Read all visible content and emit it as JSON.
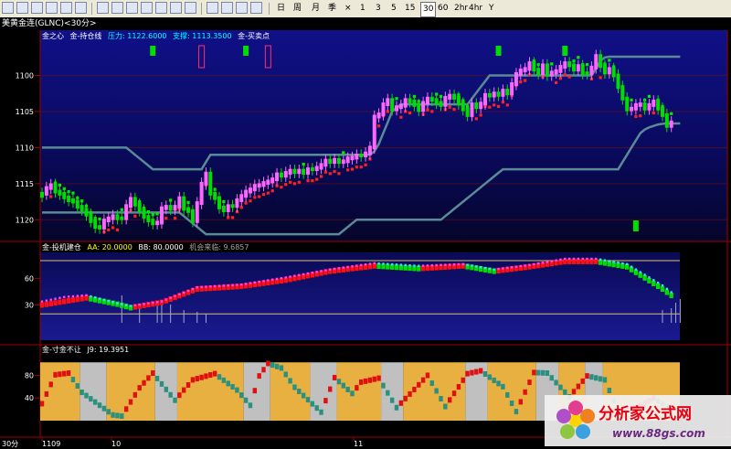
{
  "toolbar": {
    "period_buttons": [
      "日",
      "周",
      "月",
      "季",
      "×",
      "1",
      "3",
      "5",
      "15",
      "30",
      "60",
      "2hr",
      "4hr",
      "Y"
    ],
    "active_period": "30"
  },
  "window_title": "美黄金连(GLNC)<30分>",
  "colors": {
    "up": "#ff66ff",
    "down": "#00dd00",
    "band": "#5a8a95",
    "dots_red": "#ff2020",
    "dots_green": "#00ee00",
    "cyan": "#40d8ff",
    "gold": "#e8b040",
    "gray": "#c0c0c0",
    "axis_red": "#a00000",
    "teal": "#2a9080"
  },
  "panel1": {
    "title": "金之心",
    "indicator": "金-持仓线",
    "pressure_label": "压力:",
    "pressure_value": "1122.6000",
    "support_label": "支撑:",
    "support_value": "1113.3500",
    "signal_label": "金-买卖点",
    "y_ticks": [
      "1120",
      "1115",
      "1110",
      "1105",
      "1100"
    ]
  },
  "panel2": {
    "title": "金-投机建仓",
    "aa_label": "AA:",
    "aa_value": "20.0000",
    "bb_label": "BB:",
    "bb_value": "80.0000",
    "chance_label": "机会来临:",
    "chance_value": "9.6857",
    "y_ticks": [
      "60",
      "30"
    ]
  },
  "panel3": {
    "title": "金-寸金不让",
    "j_label": "J9:",
    "j_value": "19.3951",
    "y_ticks": [
      "80",
      "40"
    ]
  },
  "x_axis": {
    "unit": "30分",
    "labels": [
      "1109",
      "10",
      "11"
    ]
  },
  "watermark": {
    "brand": "分析家公式网",
    "url": "www.88gs.com"
  },
  "chart_data": [
    {
      "type": "candlestick",
      "title": "金之心",
      "ylim": [
        1097.5,
        1124.5
      ],
      "y_ticks": [
        1100,
        1105,
        1110,
        1115,
        1120
      ],
      "close": [
        1103.6,
        1104.4,
        1104.8,
        1103.9,
        1103.6,
        1103.1,
        1102.7,
        1102.5,
        1101.8,
        1101.4,
        1100.7,
        1099.8,
        1099.0,
        1098.9,
        1099.9,
        1100.2,
        1100.5,
        1100.2,
        1100.2,
        1101.9,
        1102.9,
        1102.1,
        1101.3,
        1100.4,
        1099.9,
        1099.5,
        1099.6,
        1101.6,
        1101.8,
        1101.5,
        1101.8,
        1103.0,
        1101.5,
        1101.2,
        1099.8,
        1102.3,
        1105.0,
        1106.4,
        1103.6,
        1103.0,
        1101.7,
        1101.3,
        1101.9,
        1101.9,
        1102.7,
        1103.3,
        1103.9,
        1104.2,
        1104.7,
        1104.8,
        1105.1,
        1105.3,
        1105.6,
        1106.3,
        1106.1,
        1106.5,
        1106.8,
        1106.6,
        1106.8,
        1106.5,
        1107.0,
        1107.0,
        1107.2,
        1107.6,
        1108.2,
        1108.0,
        1108.3,
        1108.0,
        1108.1,
        1108.5,
        1108.6,
        1108.9,
        1108.9,
        1109.2,
        1110.0,
        1114.3,
        1114.6,
        1116.0,
        1116.6,
        1115.3,
        1115.6,
        1115.8,
        1116.6,
        1116.4,
        1115.9,
        1115.2,
        1116.2,
        1116.8,
        1116.6,
        1116.2,
        1115.9,
        1116.9,
        1117.2,
        1116.9,
        1116.1,
        1115.3,
        1114.5,
        1116.0,
        1115.6,
        1116.1,
        1117.3,
        1117.2,
        1117.5,
        1117.3,
        1117.9,
        1117.5,
        1118.8,
        1120.2,
        1120.7,
        1120.9,
        1121.7,
        1120.8,
        1120.3,
        1121.4,
        1120.1,
        1120.4,
        1120.6,
        1121.2,
        1121.7,
        1121.4,
        1120.8,
        1121.3,
        1120.3,
        1120.3,
        1121.1,
        1122.7,
        1121.3,
        1120.4,
        1120.9,
        1120.0,
        1118.4,
        1116.8,
        1115.3,
        1115.4,
        1115.9,
        1116.0,
        1115.4,
        1115.9,
        1116.4,
        1115.4,
        1114.5,
        1113.0,
        1113.5
      ],
      "up_bar": [
        0,
        1,
        1,
        0,
        0,
        0,
        0,
        0,
        0,
        0,
        0,
        0,
        0,
        0,
        1,
        1,
        1,
        0,
        0,
        1,
        1,
        0,
        0,
        0,
        0,
        0,
        1,
        1,
        1,
        0,
        1,
        1,
        0,
        0,
        0,
        1,
        1,
        1,
        0,
        0,
        0,
        0,
        1,
        0,
        1,
        1,
        1,
        1,
        1,
        1,
        1,
        1,
        1,
        1,
        0,
        1,
        1,
        0,
        1,
        0,
        1,
        0,
        1,
        1,
        1,
        0,
        1,
        0,
        1,
        1,
        1,
        1,
        0,
        1,
        1,
        1,
        1,
        1,
        1,
        0,
        1,
        1,
        1,
        0,
        0,
        0,
        1,
        1,
        0,
        0,
        0,
        1,
        1,
        0,
        0,
        0,
        0,
        1,
        0,
        1,
        1,
        0,
        1,
        0,
        1,
        0,
        1,
        1,
        1,
        1,
        1,
        0,
        0,
        1,
        0,
        1,
        1,
        1,
        1,
        0,
        0,
        1,
        0,
        0,
        1,
        1,
        0,
        0,
        1,
        0,
        0,
        0,
        0,
        1,
        1,
        1,
        0,
        1,
        1,
        0,
        0,
        0,
        1
      ],
      "resistance": [
        1110.0,
        1110.0,
        1110.0,
        1110.0,
        1110.0,
        1110.0,
        1110.0,
        1110.0,
        1110.0,
        1110.0,
        1110.0,
        1110.0,
        1110.0,
        1110.0,
        1110.0,
        1110.0,
        1110.0,
        1110.0,
        1110.0,
        1110.0,
        1109.5,
        1109.0,
        1108.5,
        1108.0,
        1107.5,
        1107.0,
        1107.0,
        1107.0,
        1107.0,
        1107.0,
        1107.0,
        1107.0,
        1107.0,
        1107.0,
        1107.0,
        1107.0,
        1107.0,
        1108.0,
        1109.0,
        1109.0,
        1109.0,
        1109.0,
        1109.0,
        1109.0,
        1109.0,
        1109.0,
        1109.0,
        1109.0,
        1109.0,
        1109.0,
        1109.0,
        1109.0,
        1109.0,
        1109.0,
        1109.0,
        1109.0,
        1109.0,
        1109.0,
        1109.0,
        1109.0,
        1109.0,
        1109.0,
        1109.0,
        1109.0,
        1109.0,
        1109.0,
        1109.0,
        1109.0,
        1109.0,
        1109.0,
        1109.0,
        1109.0,
        1109.0,
        1109.0,
        1109.0,
        1109.5,
        1110.5,
        1112.0,
        1113.5,
        1115.0,
        1115.5,
        1116.0,
        1116.0,
        1116.0,
        1116.0,
        1116.0,
        1116.0,
        1116.0,
        1116.0,
        1116.0,
        1116.0,
        1116.0,
        1116.0,
        1116.0,
        1116.0,
        1116.0,
        1116.0,
        1116.8,
        1117.6,
        1118.4,
        1119.2,
        1120.0,
        1120.0,
        1120.0,
        1120.0,
        1120.0,
        1120.0,
        1120.0,
        1120.0,
        1120.0,
        1120.0,
        1120.0,
        1120.0,
        1120.0,
        1120.0,
        1120.0,
        1120.0,
        1120.0,
        1120.0,
        1120.0,
        1120.0,
        1120.0,
        1120.0,
        1120.0,
        1120.0,
        1121.0,
        1122.0,
        1122.5,
        1122.6,
        1122.6,
        1122.6,
        1122.6,
        1122.6,
        1122.6,
        1122.6,
        1122.6,
        1122.6,
        1122.6,
        1122.6,
        1122.6,
        1122.6,
        1122.6,
        1122.6,
        1122.6,
        1122.6
      ],
      "support": [
        1101.0,
        1101.0,
        1101.0,
        1101.0,
        1101.0,
        1101.0,
        1101.0,
        1101.0,
        1101.0,
        1101.0,
        1101.0,
        1101.0,
        1101.0,
        1101.0,
        1101.0,
        1101.0,
        1101.0,
        1101.0,
        1101.0,
        1101.0,
        1101.0,
        1101.0,
        1101.0,
        1101.0,
        1101.0,
        1101.0,
        1101.0,
        1101.0,
        1101.0,
        1101.0,
        1101.0,
        1101.0,
        1100.5,
        1100.0,
        1099.5,
        1099.0,
        1098.5,
        1098.0,
        1098.0,
        1098.0,
        1098.0,
        1098.0,
        1098.0,
        1098.0,
        1098.0,
        1098.0,
        1098.0,
        1098.0,
        1098.0,
        1098.0,
        1098.0,
        1098.0,
        1098.0,
        1098.0,
        1098.0,
        1098.0,
        1098.0,
        1098.0,
        1098.0,
        1098.0,
        1098.0,
        1098.0,
        1098.0,
        1098.0,
        1098.0,
        1098.0,
        1098.0,
        1098.0,
        1098.5,
        1099.0,
        1099.5,
        1100.0,
        1100.0,
        1100.0,
        1100.0,
        1100.0,
        1100.0,
        1100.0,
        1100.0,
        1100.0,
        1100.0,
        1100.0,
        1100.0,
        1100.0,
        1100.0,
        1100.0,
        1100.0,
        1100.0,
        1100.0,
        1100.0,
        1100.0,
        1100.5,
        1101.0,
        1101.5,
        1102.0,
        1102.5,
        1103.0,
        1103.5,
        1104.0,
        1104.5,
        1105.0,
        1105.5,
        1106.0,
        1106.5,
        1107.0,
        1107.0,
        1107.0,
        1107.0,
        1107.0,
        1107.0,
        1107.0,
        1107.0,
        1107.0,
        1107.0,
        1107.0,
        1107.0,
        1107.0,
        1107.0,
        1107.0,
        1107.0,
        1107.0,
        1107.0,
        1107.0,
        1107.0,
        1107.0,
        1107.0,
        1107.0,
        1107.0,
        1107.0,
        1107.0,
        1107.0,
        1108.0,
        1109.0,
        1110.0,
        1111.0,
        1112.0,
        1112.5,
        1112.8,
        1113.0,
        1113.2,
        1113.3,
        1113.35,
        1113.35,
        1113.35,
        1113.35
      ],
      "signals": [
        {
          "bar": 25,
          "kind": "down"
        },
        {
          "bar": 36,
          "kind": "up_outline"
        },
        {
          "bar": 46,
          "kind": "down"
        },
        {
          "bar": 51,
          "kind": "up_outline"
        },
        {
          "bar": 103,
          "kind": "down"
        },
        {
          "bar": 118,
          "kind": "down"
        },
        {
          "bar": 134,
          "kind": "down_low"
        }
      ]
    },
    {
      "type": "line",
      "title": "金-投机建仓",
      "ylim": [
        10,
        82
      ],
      "y_ticks": [
        30,
        60
      ],
      "reference_lines": [
        20,
        80
      ],
      "series": [
        {
          "name": "AA",
          "value": 20.0
        },
        {
          "name": "BB",
          "value": 80.0
        },
        {
          "name": "机会来临",
          "value": 9.6857
        }
      ],
      "x_keys": [
        0,
        5,
        10,
        17,
        20,
        27,
        35,
        45,
        55,
        65,
        75,
        85,
        95,
        102,
        110,
        118,
        125,
        132,
        140,
        145
      ],
      "trend_keys": [
        30,
        34,
        38,
        31,
        27,
        33,
        48,
        51,
        58,
        68,
        74,
        71,
        74,
        68,
        73,
        79,
        79,
        73,
        48,
        30
      ],
      "bull_keys": [
        34,
        39,
        41,
        32,
        29,
        34,
        50,
        53,
        61,
        70,
        77,
        74,
        76,
        70,
        75,
        82,
        82,
        76,
        52,
        33
      ]
    },
    {
      "type": "line",
      "title": "金-寸金不让",
      "ylim": [
        0,
        105
      ],
      "y_ticks": [
        40,
        80
      ],
      "series": [
        {
          "name": "J9",
          "value": 19.3951
        }
      ],
      "x_keys": [
        0,
        3,
        6,
        9,
        16,
        18,
        22,
        25,
        30,
        34,
        39,
        44,
        47,
        49,
        51,
        54,
        57,
        63,
        66,
        70,
        72,
        76,
        80,
        84,
        87,
        91,
        96,
        99,
        104,
        107,
        111,
        114,
        119,
        123,
        127,
        130,
        134,
        138,
        141,
        145
      ],
      "values": [
        30,
        81,
        84,
        50,
        10,
        8,
        58,
        84,
        36,
        72,
        83,
        54,
        27,
        79,
        101,
        93,
        59,
        15,
        76,
        48,
        68,
        75,
        23,
        55,
        80,
        25,
        83,
        88,
        60,
        16,
        85,
        84,
        42,
        79,
        72,
        16,
        22,
        40,
        25,
        19
      ],
      "band_edges": [
        9,
        15,
        26,
        31,
        46,
        52,
        61,
        67,
        77,
        82,
        96,
        101,
        112,
        117,
        123,
        127
      ],
      "band_fill": [
        "gray",
        "gold",
        "gray",
        "gold",
        "gray",
        "gold",
        "gray",
        "gold",
        "gray",
        "gold",
        "gray",
        "gold",
        "gray",
        "gold",
        "gray",
        "gold"
      ]
    }
  ]
}
